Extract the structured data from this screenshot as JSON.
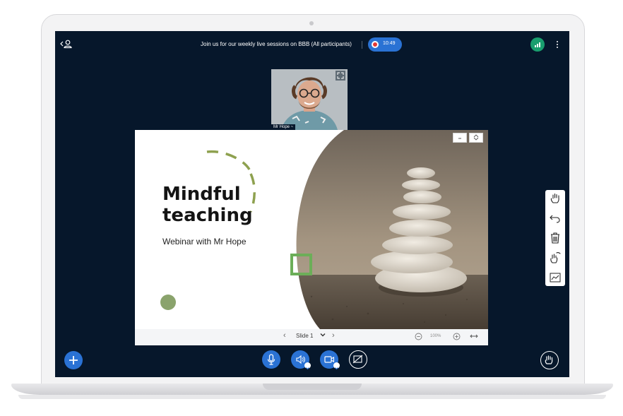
{
  "window": {
    "meeting_title": "Join us for our weekly live sessions on BBB (All participants)",
    "recording_time": "10:49"
  },
  "webcam": {
    "user_label": "Mr Hope"
  },
  "presentation": {
    "slide_title_line1": "Mindful",
    "slide_title_line2": "teaching",
    "slide_subtitle": "Webinar with Mr Hope",
    "toolbar": {
      "slide_select": "Slide 1",
      "zoom_level": "100%"
    }
  },
  "icons": {
    "user_list": "user-list-icon",
    "record": "record-icon",
    "connection": "connection-status-icon",
    "menu": "more-vertical-icon",
    "webcam_expand": "expand-icon",
    "presentation_minimize": "minimize-icon",
    "presentation_fullscreen": "fullscreen-icon",
    "prev_slide": "chevron-left-icon",
    "next_slide": "chevron-right-icon",
    "dropdown": "chevron-down-icon",
    "zoom_out": "zoom-out-icon",
    "zoom_in": "zoom-in-icon",
    "fit_width": "fit-width-icon",
    "annotation_tools": [
      "hand-icon",
      "undo-icon",
      "trash-icon",
      "multi-user-whiteboard-icon",
      "chart-icon"
    ],
    "actions": "plus-icon",
    "mic": "microphone-icon",
    "audio": "speaker-icon",
    "camera": "video-camera-icon",
    "screenshare": "screenshare-off-icon",
    "raise_hand": "raise-hand-icon"
  },
  "colors": {
    "background": "#06172b",
    "accent_blue": "#2a72d4",
    "record_red": "#e53935",
    "connection_green": "#199e6e",
    "slide_green": "#6cae58",
    "slide_olive": "#8aa36c"
  }
}
